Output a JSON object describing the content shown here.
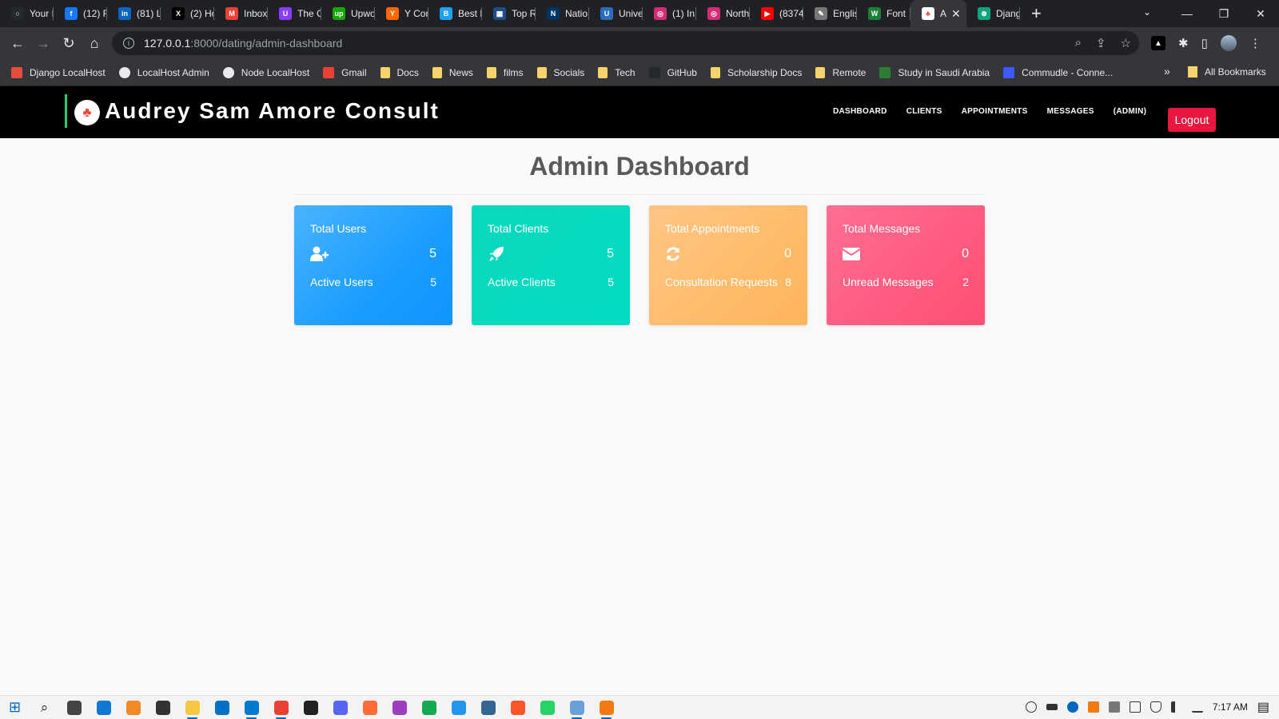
{
  "browser": {
    "tabs": [
      {
        "title": "Your F",
        "color": "#24292e",
        "glyph": "○"
      },
      {
        "title": "(12) F",
        "color": "#1877f2",
        "glyph": "f"
      },
      {
        "title": "(81) L",
        "color": "#0a66c2",
        "glyph": "in"
      },
      {
        "title": "(2) Ho",
        "color": "#000000",
        "glyph": "X"
      },
      {
        "title": "Inbox",
        "color": "#ea4335",
        "glyph": "M"
      },
      {
        "title": "The C",
        "color": "#8b3dff",
        "glyph": "U"
      },
      {
        "title": "Upwo",
        "color": "#14a800",
        "glyph": "up"
      },
      {
        "title": "Y Con",
        "color": "#ff6600",
        "glyph": "Y"
      },
      {
        "title": "Best F",
        "color": "#1da1f2",
        "glyph": "B"
      },
      {
        "title": "Top R",
        "color": "#1e4d8c",
        "glyph": "▦"
      },
      {
        "title": "Natio",
        "color": "#003366",
        "glyph": "N"
      },
      {
        "title": "Unive",
        "color": "#2a6ebb",
        "glyph": "U"
      },
      {
        "title": "(1) In",
        "color": "#d62976",
        "glyph": "◎"
      },
      {
        "title": "North",
        "color": "#d62976",
        "glyph": "◎"
      },
      {
        "title": "(8374",
        "color": "#ff0000",
        "glyph": "▶"
      },
      {
        "title": "Englis",
        "color": "#777777",
        "glyph": "✎"
      },
      {
        "title": "Font",
        "color": "#1a7f37",
        "glyph": "W"
      }
    ],
    "active_tab": {
      "title": "A",
      "close": "✕"
    },
    "last_tab": {
      "title": "Djang",
      "color": "#10a37f",
      "glyph": "⊛"
    },
    "new_tab": "+",
    "tab_search": "⌄",
    "window_controls": {
      "minimize": "—",
      "restore": "❐",
      "close": "✕"
    },
    "nav": {
      "back": "←",
      "forward": "→",
      "reload": "↻",
      "home": "⌂"
    },
    "url": {
      "host": "127.0.0.1",
      "path": ":8000/dating/admin-dashboard"
    },
    "omnibox_icons": {
      "zoom": "⌕",
      "share": "⇪",
      "star": "☆"
    },
    "extensions": {
      "ext1": "▲",
      "puzzle": "✱",
      "sidepanel": "▯",
      "menu": "⋮"
    },
    "bookmarks": [
      {
        "label": "Django LocalHost",
        "kind": "site",
        "color": "#e74c3c"
      },
      {
        "label": "LocalHost Admin",
        "kind": "globe",
        "color": "#e8eaed"
      },
      {
        "label": "Node LocalHost",
        "kind": "globe",
        "color": "#e8eaed"
      },
      {
        "label": "Gmail",
        "kind": "site",
        "color": "#ea4335"
      },
      {
        "label": "Docs",
        "kind": "folder",
        "color": "#f6d36b"
      },
      {
        "label": "News",
        "kind": "folder",
        "color": "#f6d36b"
      },
      {
        "label": "films",
        "kind": "folder",
        "color": "#f6d36b"
      },
      {
        "label": "Socials",
        "kind": "folder",
        "color": "#f6d36b"
      },
      {
        "label": "Tech",
        "kind": "folder",
        "color": "#f6d36b"
      },
      {
        "label": "GitHub",
        "kind": "site",
        "color": "#24292e"
      },
      {
        "label": "Scholarship Docs",
        "kind": "folder",
        "color": "#f6d36b"
      },
      {
        "label": "Remote",
        "kind": "folder",
        "color": "#f6d36b"
      },
      {
        "label": "Study in Saudi Arabia",
        "kind": "site",
        "color": "#2e7d32"
      },
      {
        "label": "Commudle - Conne...",
        "kind": "site",
        "color": "#3d5afe"
      }
    ],
    "bookmarks_more": "»",
    "all_bookmarks": "All Bookmarks"
  },
  "site": {
    "brand": "Audrey Sam Amore Consult",
    "brand_logo_glyph": "♣",
    "nav": [
      "DASHBOARD",
      "CLIENTS",
      "APPOINTMENTS",
      "MESSAGES",
      "(ADMIN)"
    ],
    "logout": "Logout"
  },
  "dashboard": {
    "title": "Admin Dashboard",
    "cards": [
      {
        "title": "Total Users",
        "icon": "user-plus-icon",
        "value": "5",
        "sub_label": "Active Users",
        "sub_value": "5",
        "color": "#1a9dff"
      },
      {
        "title": "Total Clients",
        "icon": "rocket-icon",
        "value": "5",
        "sub_label": "Active Clients",
        "sub_value": "5",
        "color": "#03dcc2"
      },
      {
        "title": "Total Appointments",
        "icon": "refresh-icon",
        "value": "0",
        "sub_label": "Consultation Requests",
        "sub_value": "8",
        "color": "#ffb458"
      },
      {
        "title": "Total Messages",
        "icon": "envelope-icon",
        "value": "0",
        "sub_label": "Unread Messages",
        "sub_value": "2",
        "color": "#ff4e74"
      }
    ]
  },
  "taskbar": {
    "start": "⊞",
    "search": "⌕",
    "apps": [
      {
        "name": "task-view",
        "color": "#444444"
      },
      {
        "name": "edge",
        "color": "#0f78d4"
      },
      {
        "name": "sublime",
        "color": "#f08a24"
      },
      {
        "name": "store",
        "color": "#333333"
      },
      {
        "name": "explorer",
        "color": "#f7c744"
      },
      {
        "name": "mail",
        "color": "#0072c6"
      },
      {
        "name": "vscode",
        "color": "#007acc"
      },
      {
        "name": "chrome",
        "color": "#e94235"
      },
      {
        "name": "notes",
        "color": "#222222"
      },
      {
        "name": "discord",
        "color": "#5865f2"
      },
      {
        "name": "postman",
        "color": "#ff6c37"
      },
      {
        "name": "mongo-compass",
        "color": "#9c3fbf"
      },
      {
        "name": "mongodb",
        "color": "#13aa52"
      },
      {
        "name": "docker",
        "color": "#2496ed"
      },
      {
        "name": "postgres",
        "color": "#336791"
      },
      {
        "name": "brave",
        "color": "#fb542b"
      },
      {
        "name": "whatsapp",
        "color": "#25d366"
      },
      {
        "name": "remote-desktop",
        "color": "#6aa0d8"
      },
      {
        "name": "vlc",
        "color": "#f27b11"
      }
    ],
    "clock": "7:17 AM",
    "notification": "▤"
  }
}
